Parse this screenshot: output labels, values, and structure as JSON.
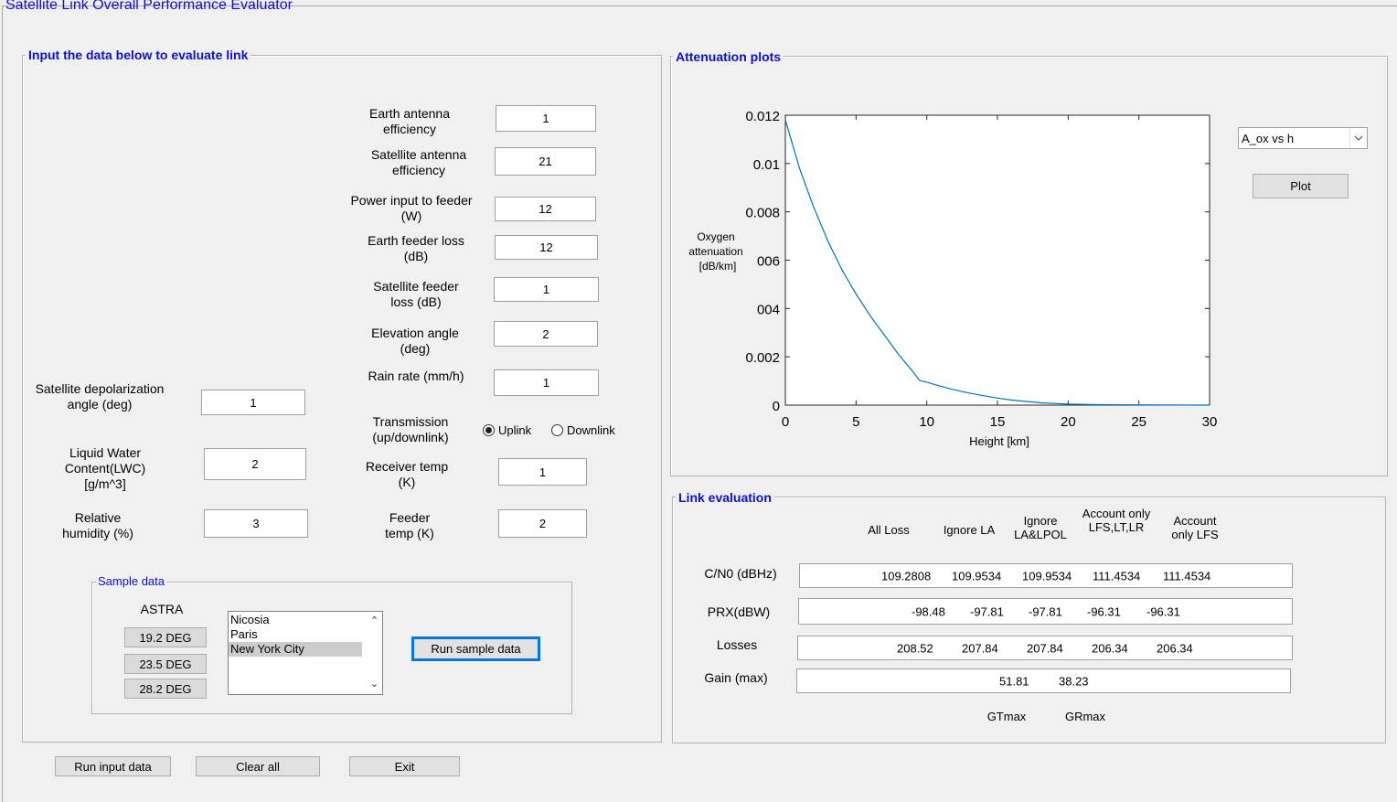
{
  "window": {
    "title": "Satellite Link  Overall Performance Evaluator"
  },
  "input_panel": {
    "title": "Input the data below to evaluate link",
    "fields": [
      {
        "key": "earth_eff",
        "label1": "Earth antenna",
        "label2": "efficiency",
        "value": "1"
      },
      {
        "key": "sat_eff",
        "label1": "Satellite antenna",
        "label2": "efficiency",
        "value": "21"
      },
      {
        "key": "power",
        "label1": "Power input to feeder",
        "label2": "(W)",
        "value": "12"
      },
      {
        "key": "earth_feeder",
        "label1": "Earth feeder loss",
        "label2": "(dB)",
        "value": "12"
      },
      {
        "key": "sat_feeder",
        "label1": "Satellite feeder",
        "label2": "loss (dB)",
        "value": "1"
      },
      {
        "key": "elev",
        "label1": "Elevation angle",
        "label2": "(deg)",
        "value": "2"
      },
      {
        "key": "rain",
        "label1": "Rain rate (mm/h)",
        "label2": "",
        "value": "1"
      },
      {
        "key": "depol",
        "label1": "Satellite depolarization",
        "label2": "angle (deg)",
        "value": "1"
      },
      {
        "key": "lwc",
        "label1": "Liquid Water",
        "label2": "Content(LWC)",
        "label3": "[g/m^3]",
        "value": "2"
      },
      {
        "key": "rh",
        "label1": "Relative",
        "label2": "humidity (%)",
        "value": "3"
      },
      {
        "key": "rx_temp",
        "label1": "Receiver temp",
        "label2": "(K)",
        "value": "1"
      },
      {
        "key": "feeder_temp",
        "label1": "Feeder",
        "label2": "temp (K)",
        "value": "2"
      }
    ],
    "transmission": {
      "label1": "Transmission",
      "label2": "(up/downlink)",
      "uplink": "Uplink",
      "downlink": "Downlink",
      "selected": "Uplink"
    }
  },
  "sample": {
    "title": "Sample data",
    "satellite_label": "ASTRA",
    "deg_buttons": [
      "19.2 DEG",
      "23.5 DEG",
      "28.2 DEG"
    ],
    "cities": [
      "Nicosia",
      "Paris",
      "New York City"
    ],
    "selected_city": "New York City",
    "run_label": "Run sample data"
  },
  "bottom_buttons": {
    "run": "Run input data",
    "clear": "Clear all",
    "exit": "Exit"
  },
  "attenuation": {
    "title": "Attenuation plots",
    "dropdown_value": "A_ox vs h",
    "plot_label": "Plot"
  },
  "chart_data": {
    "type": "line",
    "title": "",
    "xlabel": "Height [km]",
    "ylabel_lines": [
      "Oxygen",
      "attenuation",
      "[dB/km]"
    ],
    "xlim": [
      0,
      30
    ],
    "ylim": [
      0,
      0.012
    ],
    "xticks": [
      "0",
      "5",
      "10",
      "15",
      "20",
      "25",
      "30"
    ],
    "yticks": [
      "0",
      "0.002",
      "004",
      "006",
      "0.008",
      "0.01",
      "0.012"
    ],
    "grid": false,
    "color": "#0072bd",
    "x": [
      0,
      1,
      2,
      3,
      4,
      5,
      6,
      7,
      8,
      9,
      9.5,
      10,
      11,
      12,
      13,
      14,
      15,
      16,
      18,
      20,
      22,
      25,
      30
    ],
    "y": [
      0.0118,
      0.0098,
      0.0082,
      0.0068,
      0.0056,
      0.0046,
      0.0037,
      0.0029,
      0.0021,
      0.0014,
      0.00102,
      0.00095,
      0.00078,
      0.00063,
      0.0005,
      0.00039,
      0.00029,
      0.00021,
      0.0001,
      4e-05,
      2e-05,
      1e-05,
      0.0
    ]
  },
  "link_eval": {
    "title": "Link evaluation",
    "columns": [
      {
        "l1": "All Loss",
        "l2": ""
      },
      {
        "l1": "Ignore LA",
        "l2": ""
      },
      {
        "l1": "Ignore",
        "l2": "LA&LPOL"
      },
      {
        "l1": "Account only",
        "l2": "LFS,LT,LR"
      },
      {
        "l1": "Account",
        "l2": "only LFS"
      }
    ],
    "rows": [
      {
        "label": "C/N0 (dBHz)",
        "values": [
          "109.2808",
          "109.9534",
          "109.9534",
          "111.4534",
          "111.4534"
        ]
      },
      {
        "label": "PRX(dBW)",
        "values": [
          "-98.48",
          "-97.81",
          "-97.81",
          "-96.31",
          "-96.31"
        ]
      },
      {
        "label": "Losses",
        "values": [
          "208.52",
          "207.84",
          "207.84",
          "206.34",
          "206.34"
        ]
      }
    ],
    "gain": {
      "label": "Gain (max)",
      "values": [
        "51.81",
        "38.23"
      ],
      "captions": [
        "GTmax",
        "GRmax"
      ]
    }
  }
}
